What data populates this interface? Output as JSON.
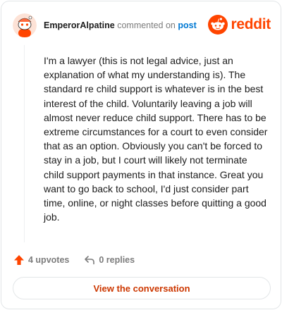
{
  "header": {
    "username": "EmperorAlpatine",
    "action_text": "commented on",
    "target_text": "post",
    "brand_name": "reddit"
  },
  "comment": {
    "body": "I'm a lawyer (this is not legal advice, just an explanation of what my understanding is). The standard re child support is whatever is in the best interest of the child. Voluntarily leaving a job will almost never reduce child support. There has to be extreme circumstances for a court to even consider that as an option. Obviously you can't be forced to stay in a job, but I court will likely not terminate child support payments in that instance. Great you want to go back to school, I'd just consider part time, online, or night classes before quitting a good job."
  },
  "stats": {
    "upvotes_label": "4 upvotes",
    "replies_label": "0 replies"
  },
  "actions": {
    "view_conversation_label": "View the conversation"
  },
  "icons": {
    "avatar": "snoo-avatar-icon",
    "brand": "reddit-logo-icon",
    "upvote": "upvote-arrow-icon",
    "reply": "reply-arrow-icon"
  },
  "colors": {
    "brand_orange": "#ff4500",
    "link_blue": "#0079d3",
    "button_text": "#cc3700",
    "muted_text": "#7c7c7c"
  }
}
